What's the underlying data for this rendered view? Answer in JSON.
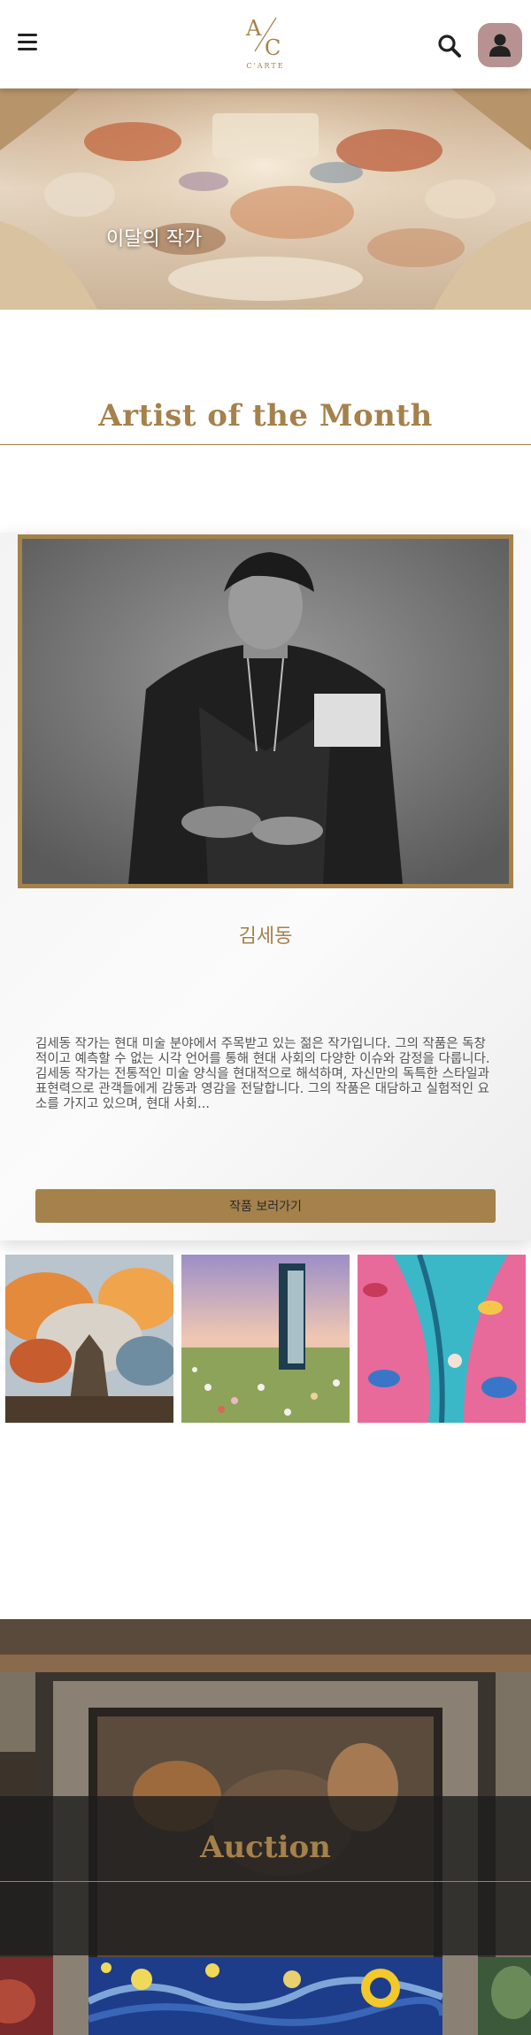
{
  "header": {
    "logo_monogram": "A/C",
    "logo_text": "C'ARTE",
    "menu_icon": "hamburger-icon",
    "search_icon": "search-icon",
    "account_icon": "user-icon"
  },
  "hero": {
    "title": "이달의 작가"
  },
  "artist_of_month": {
    "section_title": "Artist of the Month",
    "name": "김세동",
    "bio": "김세동 작가는 현대 미술 분야에서 주목받고 있는 젊은 작가입니다. 그의 작품은 독창적이고 예측할 수 없는 시각 언어를 통해 현대 사회의 다양한 이슈와 감정을 다룹니다. 김세동 작가는 전통적인 미술 양식을 현대적으로 해석하며, 자신만의 독특한 스타일과 표현력으로 관객들에게 감동과 영감을 전달합니다. 그의 작품은 대담하고 실험적인 요소를 가지고 있으며, 현대 사회...",
    "cta_label": "작품 보러가기"
  },
  "auction": {
    "section_title": "Auction"
  },
  "colors": {
    "accent": "#a5814b",
    "account_bg": "#b89292",
    "card_bg": "#f5f5f5"
  }
}
